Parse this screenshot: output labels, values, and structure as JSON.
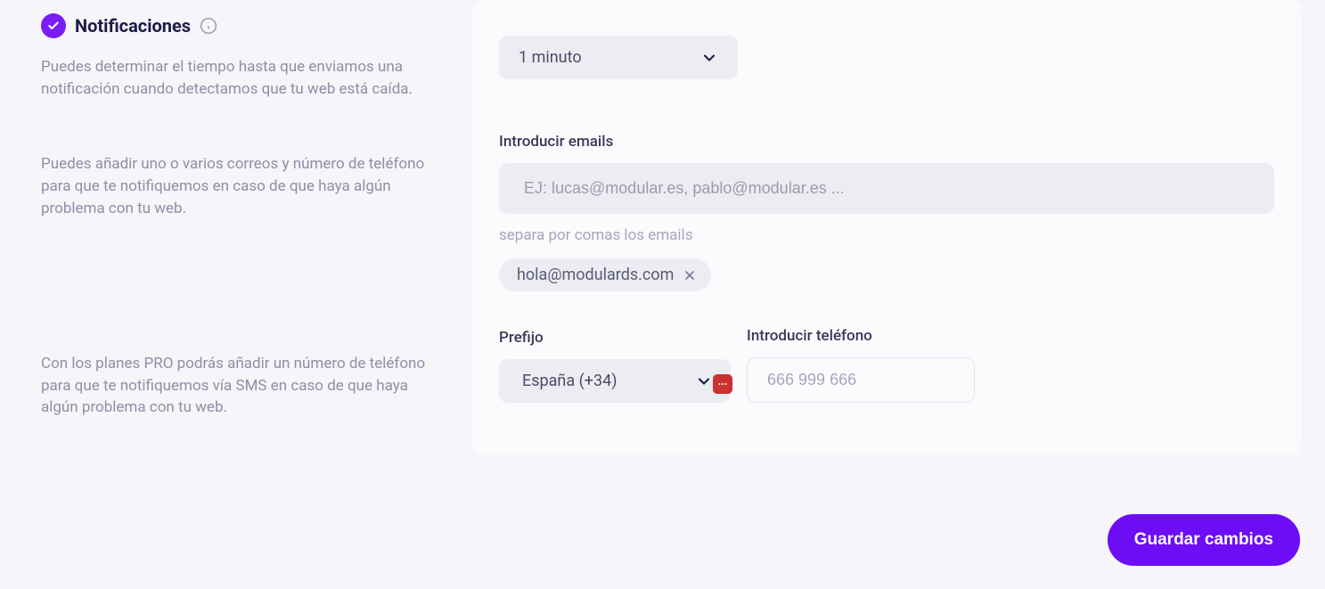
{
  "section": {
    "title": "Notificaciones",
    "desc1": "Puedes determinar el tiempo hasta que enviamos una notificación cuando detectamos que tu web está caída.",
    "desc2": "Puedes añadir uno o varios correos y número de teléfono para que te notifiquemos en caso de que haya algún problema con tu web.",
    "desc3": "Con los planes PRO podrás añadir un número de teléfono para que te notifiquemos vía SMS en caso de que haya algún problema con tu web."
  },
  "time_select": {
    "value": "1 minuto"
  },
  "emails": {
    "label": "Introducir emails",
    "placeholder": "EJ: lucas@modular.es, pablo@modular.es ...",
    "hint": "separa por comas los emails",
    "chips": [
      "hola@modulards.com"
    ]
  },
  "phone": {
    "prefix_label": "Prefijo",
    "prefix_value": "España (+34)",
    "phone_label": "Introducir teléfono",
    "phone_placeholder": "666 999 666"
  },
  "save_button": "Guardar cambios"
}
